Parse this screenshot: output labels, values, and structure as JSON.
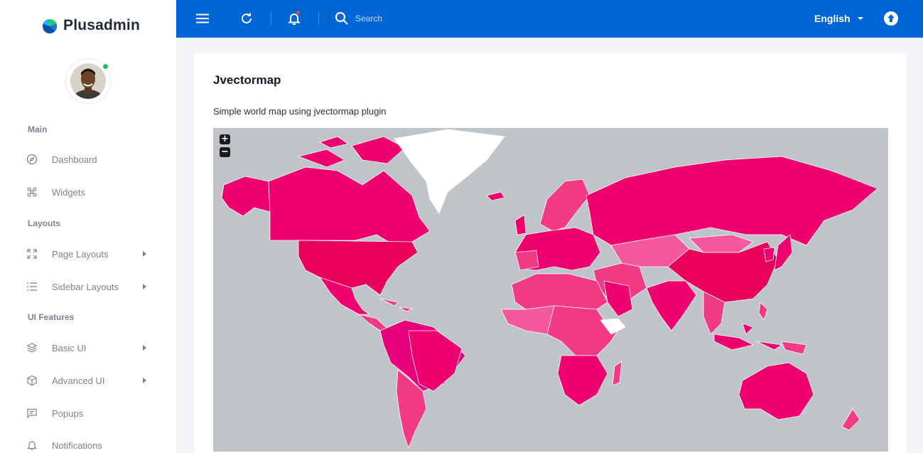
{
  "brand": {
    "name": "Plusadmin"
  },
  "sidebar": {
    "sections": [
      {
        "title": "Main"
      },
      {
        "title": "Layouts"
      },
      {
        "title": "UI Features"
      }
    ],
    "items": [
      {
        "label": "Dashboard",
        "icon": "compass-icon"
      },
      {
        "label": "Widgets",
        "icon": "widgets-icon"
      },
      {
        "label": "Page Layouts",
        "icon": "expand-icon",
        "has_submenu": true
      },
      {
        "label": "Sidebar Layouts",
        "icon": "list-icon",
        "has_submenu": true
      },
      {
        "label": "Basic UI",
        "icon": "layers-icon",
        "has_submenu": true
      },
      {
        "label": "Advanced UI",
        "icon": "cube-icon",
        "has_submenu": true
      },
      {
        "label": "Popups",
        "icon": "message-icon"
      },
      {
        "label": "Notifications",
        "icon": "bell-icon"
      }
    ],
    "user_status": "online"
  },
  "topbar": {
    "search": {
      "placeholder": "Search"
    },
    "language": "English",
    "icons": [
      "menu-icon",
      "refresh-icon",
      "bell-icon",
      "search-icon",
      "upload-icon"
    ]
  },
  "card": {
    "title": "Jvectormap",
    "subtitle": "Simple world map using jvectormap plugin",
    "map": {
      "zoom_in": "+",
      "zoom_out": "−",
      "ocean_color": "#bfc4c9",
      "land_colors": [
        "#f0006e",
        "#f23a85",
        "#e8007a",
        "#f5589c"
      ],
      "greenland_color": "#ffffff"
    }
  },
  "colors": {
    "primary": "#0066d6",
    "accent": "#f0006e",
    "online": "#22c55e",
    "notification": "#ff3b3b"
  }
}
